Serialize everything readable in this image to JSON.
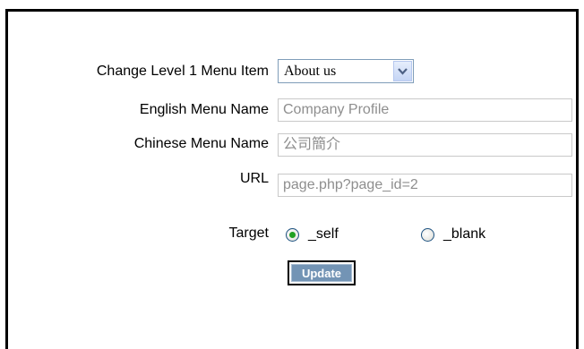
{
  "form": {
    "level1_label": "Change Level 1 Menu Item",
    "level1_selected": "About us",
    "english_label": "English Menu Name",
    "english_value": "Company Profile",
    "chinese_label": "Chinese Menu Name",
    "chinese_value": "公司簡介",
    "url_label": "URL",
    "url_value": "page.php?page_id=2",
    "target_label": "Target",
    "target_options": [
      {
        "label": "_self",
        "selected": true
      },
      {
        "label": "_blank",
        "selected": false
      }
    ],
    "update_label": "Update"
  },
  "icons": {
    "dropdown": "chevron-down-icon"
  },
  "colors": {
    "button_bg": "#7394b5",
    "radio_selected": "#21a121",
    "field_text": "#8e8e8e"
  }
}
